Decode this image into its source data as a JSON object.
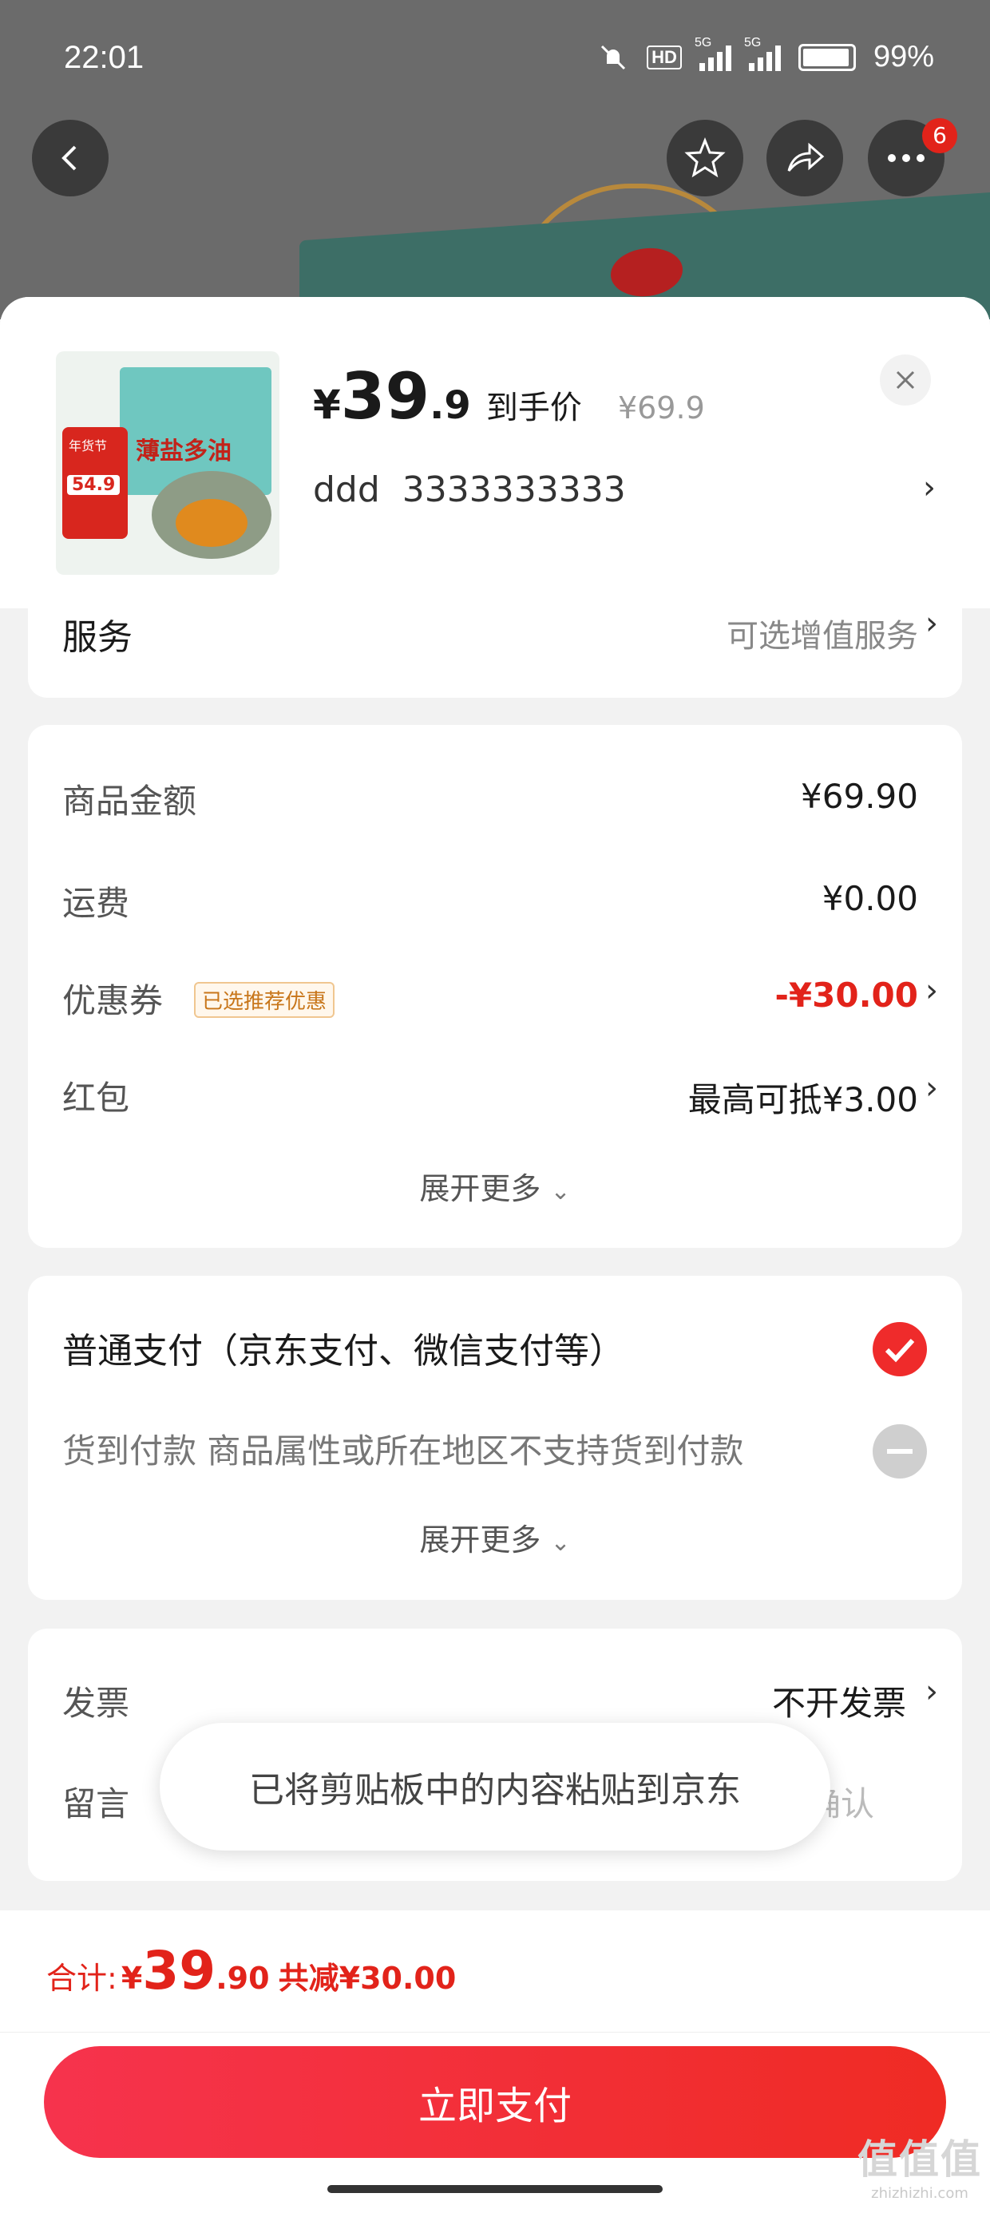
{
  "status_bar": {
    "time": "22:01",
    "hd": "HD",
    "net1": "5G",
    "net2": "5G",
    "battery": "99%"
  },
  "top_bar": {
    "notification_count": "6"
  },
  "product": {
    "currency": "¥",
    "price_int": "39",
    "price_dec": ".9",
    "price_label": "到手价",
    "original_price": "¥69.9",
    "spec": "ddd  3333333333",
    "box_text": "薄盐多油",
    "tag_text": "年货节",
    "tag_price": "54.9"
  },
  "service": {
    "label": "服务",
    "value": "可选增值服务"
  },
  "amounts": {
    "goods_label": "商品金额",
    "goods_value": "¥69.90",
    "shipping_label": "运费",
    "shipping_value": "¥0.00",
    "coupon_label": "优惠券",
    "coupon_badge": "已选推荐优惠",
    "coupon_value": "-¥30.00",
    "redpack_label": "红包",
    "redpack_value": "最高可抵¥3.00",
    "expand": "展开更多"
  },
  "payment": {
    "normal": "普通支付（京东支付、微信支付等）",
    "cod": "货到付款 商品属性或所在地区不支持货到付款",
    "expand": "展开更多"
  },
  "invoice": {
    "label": "发票",
    "value": "不开发票"
  },
  "remark": {
    "label": "留言",
    "value_hint": "确认"
  },
  "toast": "已将剪贴板中的内容粘贴到京东",
  "footer": {
    "total_label": "合计:",
    "total_currency": "¥",
    "total_int": "39",
    "total_dec": ".90",
    "discount": "共减¥30.00",
    "pay_button": "立即支付"
  },
  "watermark": {
    "text": "值值值",
    "url": "zhizhizhi.com"
  }
}
